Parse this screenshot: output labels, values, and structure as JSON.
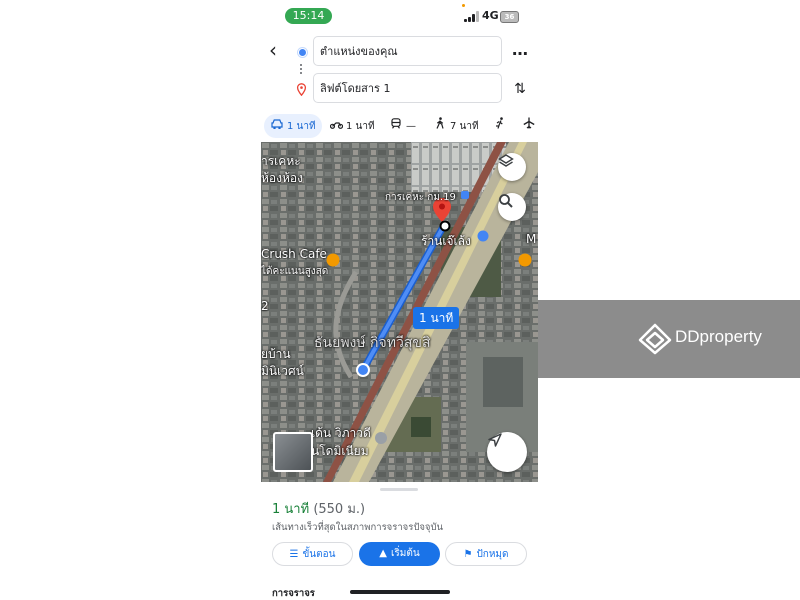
{
  "status_bar": {
    "time": "15:14",
    "network": "4G",
    "battery": "36"
  },
  "directions": {
    "origin": "ตำแหน่งของคุณ",
    "destination": "ลิฟต์โดยสาร 1"
  },
  "modes": [
    {
      "icon": "car-icon",
      "label": "1 นาที",
      "active": true
    },
    {
      "icon": "motorcycle-icon",
      "label": "1 นาที",
      "active": false
    },
    {
      "icon": "train-icon",
      "label": "—",
      "active": false
    },
    {
      "icon": "walk-icon",
      "label": "7 นาที",
      "active": false
    },
    {
      "icon": "ride-icon",
      "label": "",
      "active": false
    },
    {
      "icon": "flight-icon",
      "label": "",
      "active": false
    }
  ],
  "map": {
    "labels": {
      "top_left": "ารเคหะ",
      "top_left2": "ห้องห้อง",
      "housing19": "การเคหะ กม.19",
      "shop": "ร้านเจ๊เล้ง",
      "cafe": "Crush Cafe",
      "cafe_sub": "ได้คะแนนสูงสุด",
      "edge_m": "M",
      "edge_2": "2",
      "park": "ธันยพงษ์ กิจทวีสุขสิ",
      "village1": "ยบ้าน",
      "village2": "มินิเวศน์",
      "condo1": "เด้น วิภาวดี",
      "condo2": "นโดมิเนียม"
    },
    "route_badge": "1 นาที"
  },
  "sheet": {
    "duration": "1 นาที",
    "distance": "(550 ม.)",
    "subtitle": "เส้นทางเร็วที่สุดในสภาพการจราจรปัจจุบัน",
    "steps_label": "ขั้นตอน",
    "start_label": "เริ่มต้น",
    "pin_label": "ปักหมุด",
    "traffic_label": "การจราจร"
  },
  "watermark": {
    "brand": "DDproperty"
  },
  "colors": {
    "accent": "#1a73e8",
    "route": "#4285f4",
    "pin": "#ea4335",
    "time_green": "#188038"
  }
}
